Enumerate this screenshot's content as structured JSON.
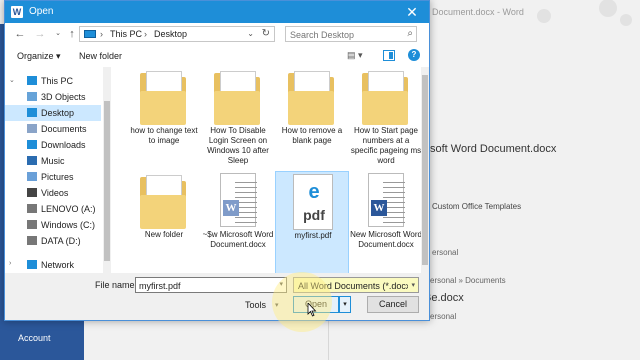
{
  "background": {
    "title": "Document.docx  -  Word",
    "account_label": "Account",
    "doc1": "soft Word Document.docx",
    "custom_templates": "Custom Office Templates",
    "personal1": "ersonal",
    "path": "ersonal » Documents",
    "doc2": "Be.docx",
    "personal2": "ersonal"
  },
  "dialog": {
    "title": "Open",
    "close_glyph": "✕",
    "title_icon_glyph": "W"
  },
  "nav": {
    "back_glyph": "←",
    "forward_glyph": "→",
    "recent_glyph": "⌄",
    "up_glyph": "↑",
    "breadcrumb": [
      "This PC",
      "Desktop"
    ],
    "separator": "›",
    "dropdown_glyph": "⌄",
    "refresh_glyph": "↻",
    "search_placeholder": "Search Desktop",
    "search_glyph": "⌕"
  },
  "toolbar": {
    "organize_label": "Organize ▾",
    "new_folder_label": "New folder",
    "view_glyph": "▤ ▾",
    "help_glyph": "?"
  },
  "sidebar": {
    "items": [
      {
        "label": "This PC",
        "icon": "computer-icon",
        "chevron": "⌄",
        "selected": false
      },
      {
        "label": "3D Objects",
        "icon": "cube-icon",
        "chevron": "",
        "selected": false
      },
      {
        "label": "Desktop",
        "icon": "desktop-icon",
        "chevron": "",
        "selected": true
      },
      {
        "label": "Documents",
        "icon": "documents-icon",
        "chevron": "",
        "selected": false
      },
      {
        "label": "Downloads",
        "icon": "download-icon",
        "chevron": "",
        "selected": false
      },
      {
        "label": "Music",
        "icon": "music-icon",
        "chevron": "",
        "selected": false
      },
      {
        "label": "Pictures",
        "icon": "pictures-icon",
        "chevron": "",
        "selected": false
      },
      {
        "label": "Videos",
        "icon": "videos-icon",
        "chevron": "",
        "selected": false
      },
      {
        "label": "LENOVO (A:)",
        "icon": "drive-icon",
        "chevron": "",
        "selected": false
      },
      {
        "label": "Windows (C:)",
        "icon": "drive-icon",
        "chevron": "",
        "selected": false
      },
      {
        "label": "DATA (D:)",
        "icon": "drive-icon",
        "chevron": "",
        "selected": false
      },
      {
        "label": "Network",
        "icon": "network-icon",
        "chevron": "›",
        "selected": false
      }
    ]
  },
  "files": [
    {
      "label": "how to change text to image",
      "kind": "folder",
      "selected": false
    },
    {
      "label": "How To Disable Login Screen on Windows 10 after Sleep",
      "kind": "folder",
      "selected": false
    },
    {
      "label": "How to remove a blank page",
      "kind": "folder",
      "selected": false
    },
    {
      "label": "How to Start page numbers at a specific pageing ms word",
      "kind": "folder",
      "selected": false
    },
    {
      "label": "New folder",
      "kind": "folder",
      "selected": false
    },
    {
      "label": "~$w Microsoft Word Document.docx",
      "kind": "word-dim",
      "selected": false
    },
    {
      "label": "myfirst.pdf",
      "kind": "pdf",
      "selected": true
    },
    {
      "label": "New Microsoft Word Document.docx",
      "kind": "word",
      "selected": false
    }
  ],
  "pdf_icon": {
    "glyph": "e",
    "text": "pdf"
  },
  "word_icon": {
    "glyph": "W"
  },
  "bottom": {
    "file_name_label": "File name:",
    "file_name_value": "myfirst.pdf",
    "file_type": "All Word Documents (*.docx;*.d",
    "tools_label": "Tools",
    "open_label": "Open",
    "cancel_label": "Cancel",
    "dd_glyph": "▾"
  },
  "colors": {
    "titlebar": "#1e8ed8",
    "word_blue": "#2b579a",
    "selection": "#cce8ff"
  }
}
